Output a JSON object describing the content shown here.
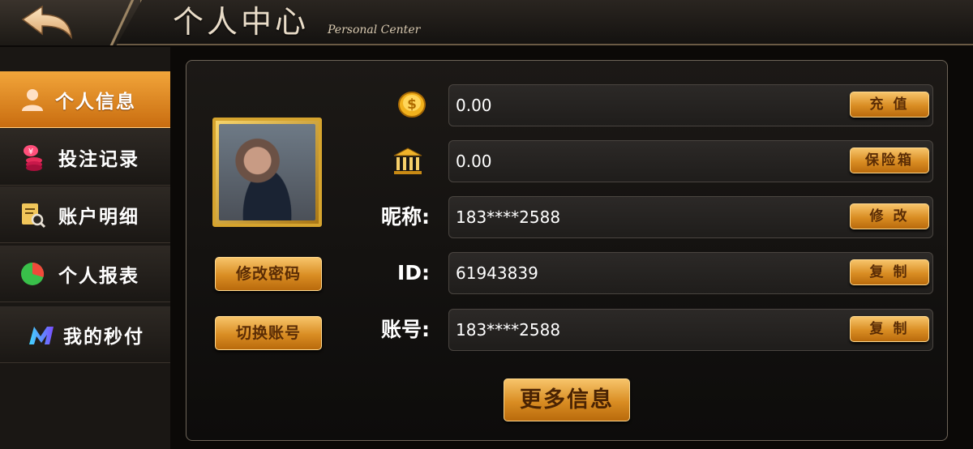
{
  "header": {
    "title_cn": "个人中心",
    "title_en": "Personal Center"
  },
  "sidebar": {
    "items": [
      {
        "label": "个人信息",
        "icon": "user-icon",
        "active": true
      },
      {
        "label": "投注记录",
        "icon": "coin-stack-icon",
        "active": false
      },
      {
        "label": "账户明细",
        "icon": "document-search-icon",
        "active": false
      },
      {
        "label": "个人报表",
        "icon": "pie-chart-icon",
        "active": false
      },
      {
        "label": "我的秒付",
        "icon": "m-logo-icon",
        "active": false
      }
    ]
  },
  "profile": {
    "change_password_label": "修改密码",
    "switch_account_label": "切换账号"
  },
  "rows": [
    {
      "label": "",
      "icon": "gold-coin-icon",
      "value": "0.00",
      "button": "充 值"
    },
    {
      "label": "",
      "icon": "bank-icon",
      "value": "0.00",
      "button": "保险箱"
    },
    {
      "label": "昵称:",
      "value": "183****2588",
      "button": "修 改"
    },
    {
      "label": "ID:",
      "value": "61943839",
      "button": "复 制"
    },
    {
      "label": "账号:",
      "value": "183****2588",
      "button": "复 制"
    }
  ],
  "more_info_label": "更多信息",
  "colors": {
    "accent": "#e39a2a",
    "background": "#0b0907",
    "active_tab": "#f2a53a"
  }
}
